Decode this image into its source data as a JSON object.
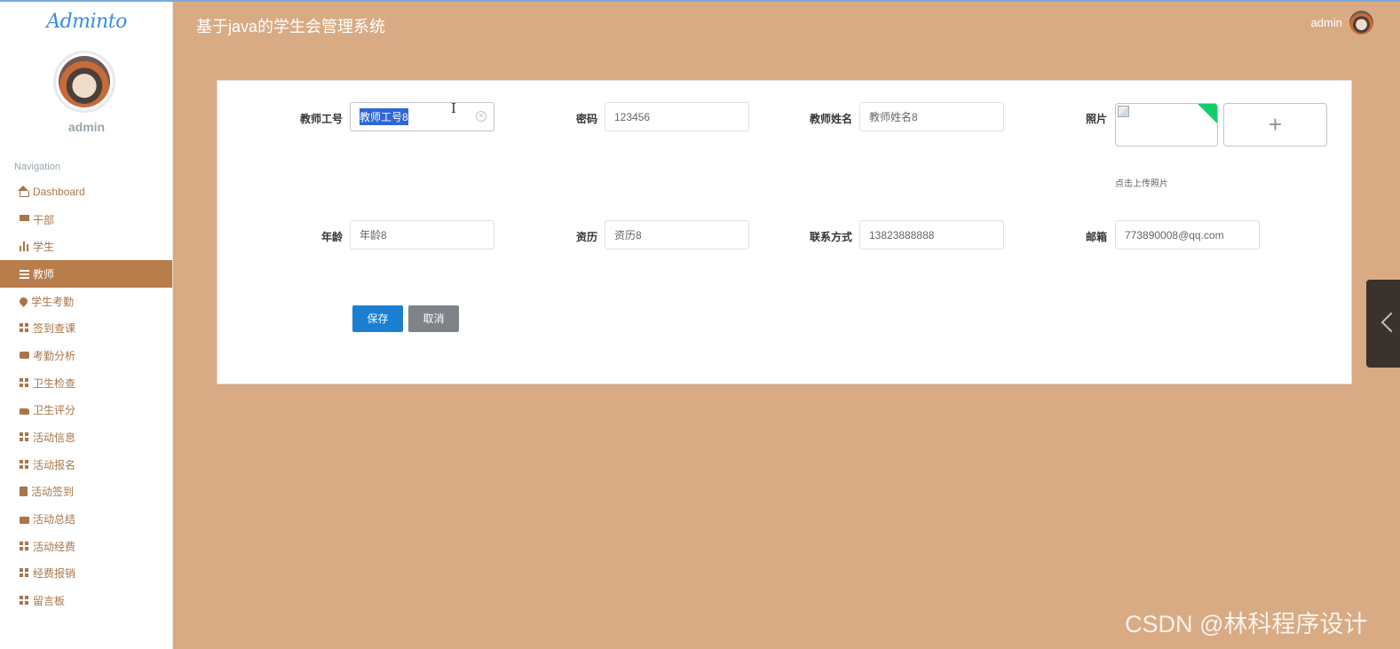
{
  "sidebar": {
    "brand": "Adminto",
    "user": "admin",
    "nav_title": "Navigation",
    "items": [
      {
        "label": "Dashboard",
        "icon": "home-icon"
      },
      {
        "label": "干部",
        "icon": "desktop-icon"
      },
      {
        "label": "学生",
        "icon": "bar-chart-icon"
      },
      {
        "label": "教师",
        "icon": "list-icon"
      },
      {
        "label": "学生考勤",
        "icon": "pin-icon"
      },
      {
        "label": "签到查课",
        "icon": "grid-icon"
      },
      {
        "label": "考勤分析",
        "icon": "ticket-icon"
      },
      {
        "label": "卫生检查",
        "icon": "grid-icon"
      },
      {
        "label": "卫生评分",
        "icon": "thumb-icon"
      },
      {
        "label": "活动信息",
        "icon": "grid-icon"
      },
      {
        "label": "活动报名",
        "icon": "grid-icon"
      },
      {
        "label": "活动签到",
        "icon": "clipboard-icon"
      },
      {
        "label": "活动总结",
        "icon": "briefcase-icon"
      },
      {
        "label": "活动经费",
        "icon": "grid-icon"
      },
      {
        "label": "经费报销",
        "icon": "grid-icon"
      },
      {
        "label": "留言板",
        "icon": "grid-icon"
      }
    ],
    "active_index": 3
  },
  "header": {
    "title": "基于java的学生会管理系统",
    "user": "admin"
  },
  "form": {
    "teacher_id": {
      "label": "教师工号",
      "value": "教师工号8"
    },
    "password": {
      "label": "密码",
      "value": "123456"
    },
    "teacher_name": {
      "label": "教师姓名",
      "value": "教师姓名8"
    },
    "photo": {
      "label": "照片",
      "upload_hint": "点击上传照片",
      "upload_plus": "+"
    },
    "age": {
      "label": "年龄",
      "value": "年龄8"
    },
    "qualification": {
      "label": "资历",
      "value": "资历8"
    },
    "contact": {
      "label": "联系方式",
      "value": "13823888888"
    },
    "email": {
      "label": "邮箱",
      "value": "773890008@qq.com"
    }
  },
  "buttons": {
    "save": "保存",
    "cancel": "取消"
  },
  "watermark": "CSDN @林科程序设计",
  "colors": {
    "background": "#d8ab84",
    "active_nav": "#b97d4b",
    "save_button": "#1a7fd1",
    "cancel_button": "#7d8389"
  }
}
